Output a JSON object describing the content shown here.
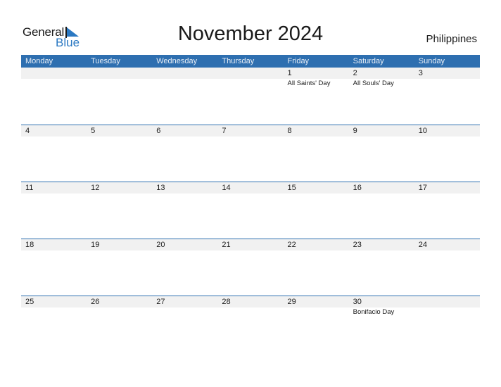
{
  "logo": {
    "general": "General",
    "blue": "Blue"
  },
  "title": "November 2024",
  "country": "Philippines",
  "weekdays": [
    "Monday",
    "Tuesday",
    "Wednesday",
    "Thursday",
    "Friday",
    "Saturday",
    "Sunday"
  ],
  "weeks": [
    [
      {
        "d": "",
        "h": ""
      },
      {
        "d": "",
        "h": ""
      },
      {
        "d": "",
        "h": ""
      },
      {
        "d": "",
        "h": ""
      },
      {
        "d": "1",
        "h": "All Saints' Day"
      },
      {
        "d": "2",
        "h": "All Souls' Day"
      },
      {
        "d": "3",
        "h": ""
      }
    ],
    [
      {
        "d": "4",
        "h": ""
      },
      {
        "d": "5",
        "h": ""
      },
      {
        "d": "6",
        "h": ""
      },
      {
        "d": "7",
        "h": ""
      },
      {
        "d": "8",
        "h": ""
      },
      {
        "d": "9",
        "h": ""
      },
      {
        "d": "10",
        "h": ""
      }
    ],
    [
      {
        "d": "11",
        "h": ""
      },
      {
        "d": "12",
        "h": ""
      },
      {
        "d": "13",
        "h": ""
      },
      {
        "d": "14",
        "h": ""
      },
      {
        "d": "15",
        "h": ""
      },
      {
        "d": "16",
        "h": ""
      },
      {
        "d": "17",
        "h": ""
      }
    ],
    [
      {
        "d": "18",
        "h": ""
      },
      {
        "d": "19",
        "h": ""
      },
      {
        "d": "20",
        "h": ""
      },
      {
        "d": "21",
        "h": ""
      },
      {
        "d": "22",
        "h": ""
      },
      {
        "d": "23",
        "h": ""
      },
      {
        "d": "24",
        "h": ""
      }
    ],
    [
      {
        "d": "25",
        "h": ""
      },
      {
        "d": "26",
        "h": ""
      },
      {
        "d": "27",
        "h": ""
      },
      {
        "d": "28",
        "h": ""
      },
      {
        "d": "29",
        "h": ""
      },
      {
        "d": "30",
        "h": "Bonifacio Day"
      },
      {
        "d": "",
        "h": ""
      }
    ]
  ]
}
